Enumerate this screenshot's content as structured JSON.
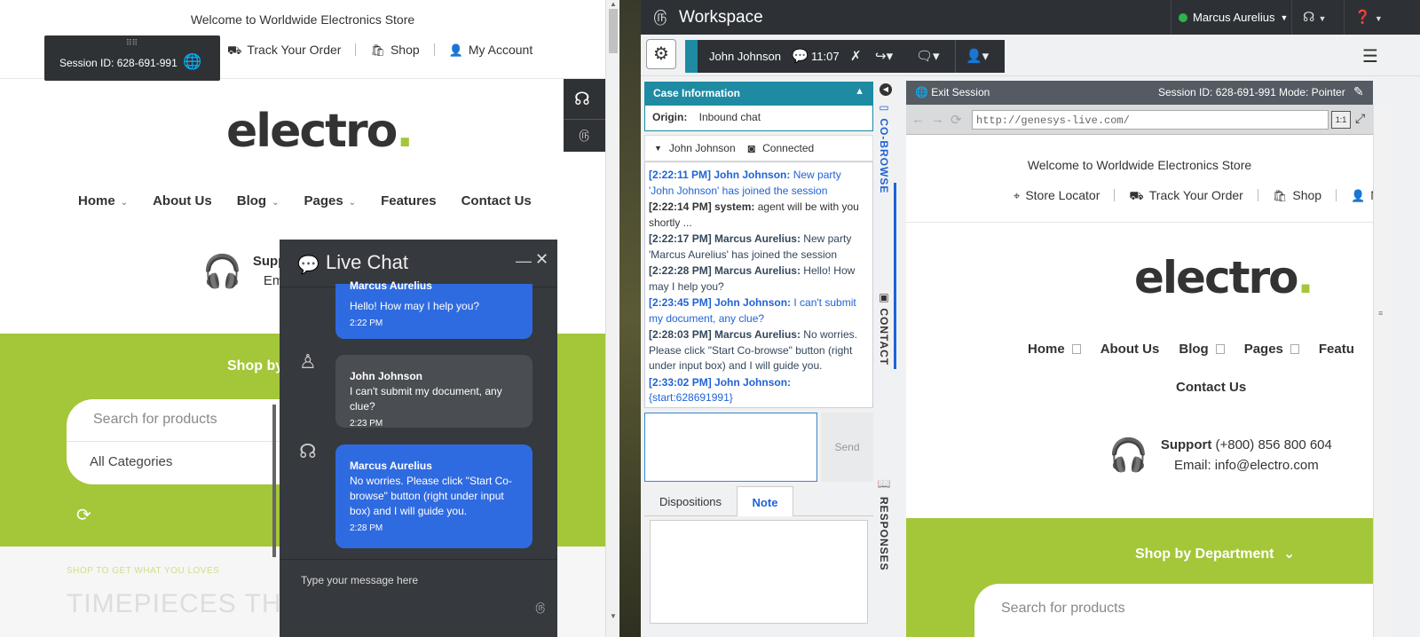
{
  "store": {
    "welcome": "Welcome to Worldwide Electronics Store",
    "top_links": [
      {
        "label": "Track Your Order",
        "icon": "truck-icon"
      },
      {
        "label": "Shop",
        "icon": "bag-icon"
      },
      {
        "label": "My Account",
        "icon": "user-icon"
      }
    ],
    "logo_text": "electro",
    "logo_dot": ".",
    "nav": [
      "Home",
      "About Us",
      "Blog",
      "Pages",
      "Features",
      "Contact Us"
    ],
    "support_partial": "Supp",
    "email_partial": "Em",
    "shop_by_partial": "Shop by",
    "search_placeholder": "Search for products",
    "all_categories": "All Categories",
    "promo_small": "SHOP TO GET WHAT YOU LOVES",
    "promo_big": "TIMEPIECES THAT",
    "accent_color": "#a4c639"
  },
  "session_overlay": {
    "session_id": "Session ID: 628-691-991"
  },
  "live_chat": {
    "title": "Live Chat",
    "messages": [
      {
        "name": "Marcus Aurelius",
        "text": "Hello! How may I help you?",
        "time": "2:22 PM",
        "role": "agent"
      },
      {
        "name": "John Johnson",
        "text": "I can't submit my document, any clue?",
        "time": "2:23 PM",
        "role": "customer"
      },
      {
        "name": "Marcus Aurelius",
        "text": "No worries. Please click \"Start Co-browse\" button (right under input box) and I will guide you.",
        "time": "2:28 PM",
        "role": "agent"
      }
    ],
    "input_placeholder": "Type your message here"
  },
  "workspace": {
    "title": "Workspace",
    "user": "Marcus Aurelius",
    "interaction": {
      "name": "John Johnson",
      "time": "11:07"
    },
    "case_info": {
      "header": "Case Information",
      "origin_label": "Origin:",
      "origin_value": "Inbound chat"
    },
    "party": {
      "name": "John Johnson",
      "status": "Connected"
    },
    "transcript": [
      {
        "time": "[2:22:11 PM]",
        "who": "John Johnson:",
        "text": "New party 'John Johnson' has joined the session",
        "role": "cust"
      },
      {
        "time": "[2:22:14 PM]",
        "who": "system:",
        "text": "agent will be with you shortly ...",
        "role": "sys"
      },
      {
        "time": "[2:22:17 PM]",
        "who": "Marcus Aurelius:",
        "text": "New party 'Marcus Aurelius' has joined the session",
        "role": "agent"
      },
      {
        "time": "[2:22:28 PM]",
        "who": "Marcus Aurelius:",
        "text": "Hello! How may I help you?",
        "role": "agent"
      },
      {
        "time": "[2:23:45 PM]",
        "who": "John Johnson:",
        "text": "I can't submit my document, any clue?",
        "role": "cust"
      },
      {
        "time": "[2:28:03 PM]",
        "who": "Marcus Aurelius:",
        "text": "No worries. Please click \"Start Co-browse\" button (right under input box) and I will guide you.",
        "role": "agent"
      },
      {
        "time": "[2:33:02 PM]",
        "who": "John Johnson:",
        "text": "{start:628691991}",
        "role": "cust"
      }
    ],
    "send_label": "Send",
    "tabs": [
      "Dispositions",
      "Note"
    ],
    "vertical_tabs": [
      "CO-BROWSE",
      "CONTACT",
      "RESPONSES"
    ],
    "cobrowse": {
      "exit_label": "Exit Session",
      "session_id": "Session ID: 628-691-991",
      "mode": "Mode: Pointer",
      "url": "http://genesys-live.com/",
      "one_to_one": "1:1"
    }
  },
  "cobrowse_page": {
    "welcome": "Welcome to Worldwide Electronics Store",
    "top_links": [
      {
        "label": "Store Locator",
        "icon": "pin-icon"
      },
      {
        "label": "Track Your Order",
        "icon": "truck-icon"
      },
      {
        "label": "Shop",
        "icon": "bag-icon"
      },
      {
        "label": "My",
        "icon": "user-icon"
      }
    ],
    "logo_text": "electro",
    "logo_dot": ".",
    "nav_row1": [
      "Home",
      "About Us",
      "Blog",
      "Pages",
      "Featu"
    ],
    "nav_row2": "Contact Us",
    "support_bold": "Support",
    "support_phone": " (+800) 856 800 604",
    "email": "Email: info@electro.com",
    "shop_by": "Shop by Department",
    "search_placeholder": "Search for products"
  }
}
